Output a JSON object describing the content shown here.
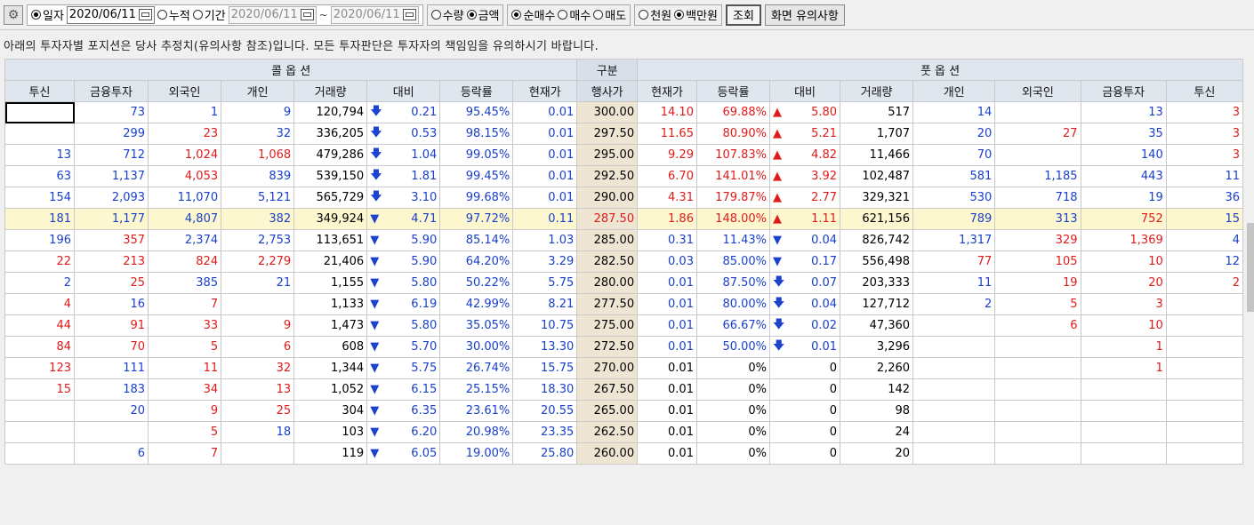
{
  "toolbar": {
    "icon": "gear-icon",
    "date_mode": {
      "daily": "일자",
      "cumulative": "누적",
      "period": "기간"
    },
    "date": "2020/06/11",
    "period_from": "2020/06/11",
    "period_sep": "~",
    "period_to": "2020/06/11",
    "qty_amount": {
      "qty": "수량",
      "amount": "금액"
    },
    "buy_sell": {
      "net": "순매수",
      "buy": "매수",
      "sell": "매도"
    },
    "unit": {
      "thousand": "천원",
      "million": "백만원"
    },
    "query_button": "조회",
    "notice_button": "화면 유의사항"
  },
  "notice": "아래의 투자자별 포지션은 당사 추정치(유의사항 참조)입니다. 모든 투자판단은 투자자의 책임임을 유의하시기 바랍니다.",
  "headers": {
    "call_group": "콜 옵 션",
    "mid_group": "구분",
    "put_group": "풋 옵 션",
    "cols": [
      "투신",
      "금융투자",
      "외국인",
      "개인",
      "거래량",
      "대비",
      "등락률",
      "현재가",
      "행사가",
      "현재가",
      "등락률",
      "대비",
      "거래량",
      "개인",
      "외국인",
      "금융투자",
      "투신"
    ]
  },
  "rows": [
    {
      "c_tu": "",
      "c_gt": "73",
      "c_fr": "1",
      "c_ind": "9",
      "c_vol": "120,794",
      "c_dir": "down-arrow",
      "c_chg": "0.21",
      "c_rate": "95.45%",
      "c_px": "0.01",
      "strike": "300.00",
      "p_px": "14.10",
      "p_rate": "69.88%",
      "p_dir": "up",
      "p_chg": "5.80",
      "p_vol": "517",
      "p_ind": "14",
      "p_fr": "",
      "p_gt": "13",
      "p_tu": "3"
    },
    {
      "c_tu": "",
      "c_gt": "299",
      "c_fr": "23",
      "c_ind": "32",
      "c_vol": "336,205",
      "c_dir": "down-arrow",
      "c_chg": "0.53",
      "c_rate": "98.15%",
      "c_px": "0.01",
      "strike": "297.50",
      "p_px": "11.65",
      "p_rate": "80.90%",
      "p_dir": "up",
      "p_chg": "5.21",
      "p_vol": "1,707",
      "p_ind": "20",
      "p_fr": "27",
      "p_gt": "35",
      "p_tu": "3"
    },
    {
      "c_tu": "13",
      "c_gt": "712",
      "c_fr": "1,024",
      "c_ind": "1,068",
      "c_vol": "479,286",
      "c_dir": "down-arrow",
      "c_chg": "1.04",
      "c_rate": "99.05%",
      "c_px": "0.01",
      "strike": "295.00",
      "p_px": "9.29",
      "p_rate": "107.83%",
      "p_dir": "up",
      "p_chg": "4.82",
      "p_vol": "11,466",
      "p_ind": "70",
      "p_fr": "",
      "p_gt": "140",
      "p_tu": "3"
    },
    {
      "c_tu": "63",
      "c_gt": "1,137",
      "c_fr": "4,053",
      "c_ind": "839",
      "c_vol": "539,150",
      "c_dir": "down-arrow",
      "c_chg": "1.81",
      "c_rate": "99.45%",
      "c_px": "0.01",
      "strike": "292.50",
      "p_px": "6.70",
      "p_rate": "141.01%",
      "p_dir": "up",
      "p_chg": "3.92",
      "p_vol": "102,487",
      "p_ind": "581",
      "p_fr": "1,185",
      "p_gt": "443",
      "p_tu": "11"
    },
    {
      "c_tu": "154",
      "c_gt": "2,093",
      "c_fr": "11,070",
      "c_ind": "5,121",
      "c_vol": "565,729",
      "c_dir": "down-arrow",
      "c_chg": "3.10",
      "c_rate": "99.68%",
      "c_px": "0.01",
      "strike": "290.00",
      "p_px": "4.31",
      "p_rate": "179.87%",
      "p_dir": "up",
      "p_chg": "2.77",
      "p_vol": "329,321",
      "p_ind": "530",
      "p_fr": "718",
      "p_gt": "19",
      "p_tu": "36"
    },
    {
      "c_tu": "181",
      "c_gt": "1,177",
      "c_fr": "4,807",
      "c_ind": "382",
      "c_vol": "349,924",
      "c_dir": "down",
      "c_chg": "4.71",
      "c_rate": "97.72%",
      "c_px": "0.11",
      "strike": "287.50",
      "p_px": "1.86",
      "p_rate": "148.00%",
      "p_dir": "up",
      "p_chg": "1.11",
      "p_vol": "621,156",
      "p_ind": "789",
      "p_fr": "313",
      "p_gt": "752",
      "p_tu": "15",
      "hl": true
    },
    {
      "c_tu": "196",
      "c_gt": "357",
      "c_fr": "2,374",
      "c_ind": "2,753",
      "c_vol": "113,651",
      "c_dir": "down",
      "c_chg": "5.90",
      "c_rate": "85.14%",
      "c_px": "1.03",
      "strike": "285.00",
      "p_px": "0.31",
      "p_rate": "11.43%",
      "p_dir": "down",
      "p_chg": "0.04",
      "p_vol": "826,742",
      "p_ind": "1,317",
      "p_fr": "329",
      "p_gt": "1,369",
      "p_tu": "4"
    },
    {
      "c_tu": "22",
      "c_gt": "213",
      "c_fr": "824",
      "c_ind": "2,279",
      "c_vol": "21,406",
      "c_dir": "down",
      "c_chg": "5.90",
      "c_rate": "64.20%",
      "c_px": "3.29",
      "strike": "282.50",
      "p_px": "0.03",
      "p_rate": "85.00%",
      "p_dir": "down",
      "p_chg": "0.17",
      "p_vol": "556,498",
      "p_ind": "77",
      "p_fr": "105",
      "p_gt": "10",
      "p_tu": "12"
    },
    {
      "c_tu": "2",
      "c_gt": "25",
      "c_fr": "385",
      "c_ind": "21",
      "c_vol": "1,155",
      "c_dir": "down",
      "c_chg": "5.80",
      "c_rate": "50.22%",
      "c_px": "5.75",
      "strike": "280.00",
      "p_px": "0.01",
      "p_rate": "87.50%",
      "p_dir": "down-arrow",
      "p_chg": "0.07",
      "p_vol": "203,333",
      "p_ind": "11",
      "p_fr": "19",
      "p_gt": "20",
      "p_tu": "2"
    },
    {
      "c_tu": "4",
      "c_gt": "16",
      "c_fr": "7",
      "c_ind": "",
      "c_vol": "1,133",
      "c_dir": "down",
      "c_chg": "6.19",
      "c_rate": "42.99%",
      "c_px": "8.21",
      "strike": "277.50",
      "p_px": "0.01",
      "p_rate": "80.00%",
      "p_dir": "down-arrow",
      "p_chg": "0.04",
      "p_vol": "127,712",
      "p_ind": "2",
      "p_fr": "5",
      "p_gt": "3",
      "p_tu": ""
    },
    {
      "c_tu": "44",
      "c_gt": "91",
      "c_fr": "33",
      "c_ind": "9",
      "c_vol": "1,473",
      "c_dir": "down",
      "c_chg": "5.80",
      "c_rate": "35.05%",
      "c_px": "10.75",
      "strike": "275.00",
      "p_px": "0.01",
      "p_rate": "66.67%",
      "p_dir": "down-arrow",
      "p_chg": "0.02",
      "p_vol": "47,360",
      "p_ind": "",
      "p_fr": "6",
      "p_gt": "10",
      "p_tu": ""
    },
    {
      "c_tu": "84",
      "c_gt": "70",
      "c_fr": "5",
      "c_ind": "6",
      "c_vol": "608",
      "c_dir": "down",
      "c_chg": "5.70",
      "c_rate": "30.00%",
      "c_px": "13.30",
      "strike": "272.50",
      "p_px": "0.01",
      "p_rate": "50.00%",
      "p_dir": "down-arrow",
      "p_chg": "0.01",
      "p_vol": "3,296",
      "p_ind": "",
      "p_fr": "",
      "p_gt": "1",
      "p_tu": ""
    },
    {
      "c_tu": "123",
      "c_gt": "111",
      "c_fr": "11",
      "c_ind": "32",
      "c_vol": "1,344",
      "c_dir": "down",
      "c_chg": "5.75",
      "c_rate": "26.74%",
      "c_px": "15.75",
      "strike": "270.00",
      "p_px": "0.01",
      "p_rate": "0%",
      "p_dir": "",
      "p_chg": "0",
      "p_vol": "2,260",
      "p_ind": "",
      "p_fr": "",
      "p_gt": "1",
      "p_tu": ""
    },
    {
      "c_tu": "15",
      "c_gt": "183",
      "c_fr": "34",
      "c_ind": "13",
      "c_vol": "1,052",
      "c_dir": "down",
      "c_chg": "6.15",
      "c_rate": "25.15%",
      "c_px": "18.30",
      "strike": "267.50",
      "p_px": "0.01",
      "p_rate": "0%",
      "p_dir": "",
      "p_chg": "0",
      "p_vol": "142",
      "p_ind": "",
      "p_fr": "",
      "p_gt": "",
      "p_tu": ""
    },
    {
      "c_tu": "",
      "c_gt": "20",
      "c_fr": "9",
      "c_ind": "25",
      "c_vol": "304",
      "c_dir": "down",
      "c_chg": "6.35",
      "c_rate": "23.61%",
      "c_px": "20.55",
      "strike": "265.00",
      "p_px": "0.01",
      "p_rate": "0%",
      "p_dir": "",
      "p_chg": "0",
      "p_vol": "98",
      "p_ind": "",
      "p_fr": "",
      "p_gt": "",
      "p_tu": ""
    },
    {
      "c_tu": "",
      "c_gt": "",
      "c_fr": "5",
      "c_ind": "18",
      "c_vol": "103",
      "c_dir": "down",
      "c_chg": "6.20",
      "c_rate": "20.98%",
      "c_px": "23.35",
      "strike": "262.50",
      "p_px": "0.01",
      "p_rate": "0%",
      "p_dir": "",
      "p_chg": "0",
      "p_vol": "24",
      "p_ind": "",
      "p_fr": "",
      "p_gt": "",
      "p_tu": ""
    },
    {
      "c_tu": "",
      "c_gt": "6",
      "c_fr": "7",
      "c_ind": "",
      "c_vol": "119",
      "c_dir": "down",
      "c_chg": "6.05",
      "c_rate": "19.00%",
      "c_px": "25.80",
      "strike": "260.00",
      "p_px": "0.01",
      "p_rate": "0%",
      "p_dir": "",
      "p_chg": "0",
      "p_vol": "20",
      "p_ind": "",
      "p_fr": "",
      "p_gt": "",
      "p_tu": ""
    }
  ],
  "colors": {
    "positive": "#e01b1b",
    "negative": "#1a3fc9",
    "strike_bg": "#efe5d3",
    "highlight_row": "#fdf7cf",
    "header_bg": "#dfe6ee"
  }
}
